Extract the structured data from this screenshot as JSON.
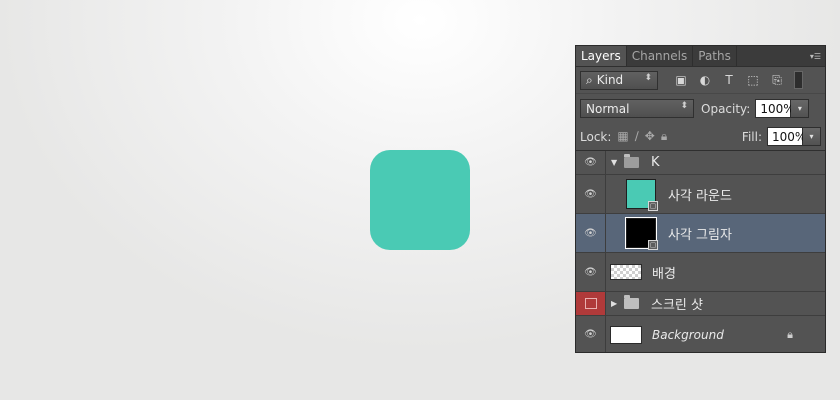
{
  "canvas": {
    "shape_color": "#4acab4"
  },
  "panel": {
    "tabs": [
      "Layers",
      "Channels",
      "Paths"
    ],
    "menu_icon": "panel-menu-icon",
    "filter": {
      "kind_label": "Kind",
      "search_icon": "⌕"
    },
    "blend": {
      "mode": "Normal",
      "opacity_label": "Opacity:",
      "opacity_value": "100%"
    },
    "lock": {
      "label": "Lock:",
      "fill_label": "Fill:",
      "fill_value": "100%"
    },
    "layers": [
      {
        "name": "K",
        "kind": "group",
        "expanded": true,
        "visible": true
      },
      {
        "name": "사각 라운드",
        "kind": "shape",
        "thumb_color": "#4acab4",
        "visible": true
      },
      {
        "name": "사각 그림자",
        "kind": "shape",
        "thumb_color": "#000000",
        "visible": true,
        "selected": true
      },
      {
        "name": "배경",
        "kind": "pixel",
        "visible": true
      },
      {
        "name": "스크린 샷",
        "kind": "group",
        "expanded": false,
        "visible": false
      },
      {
        "name": "Background",
        "kind": "background",
        "locked": true,
        "visible": true
      }
    ]
  }
}
